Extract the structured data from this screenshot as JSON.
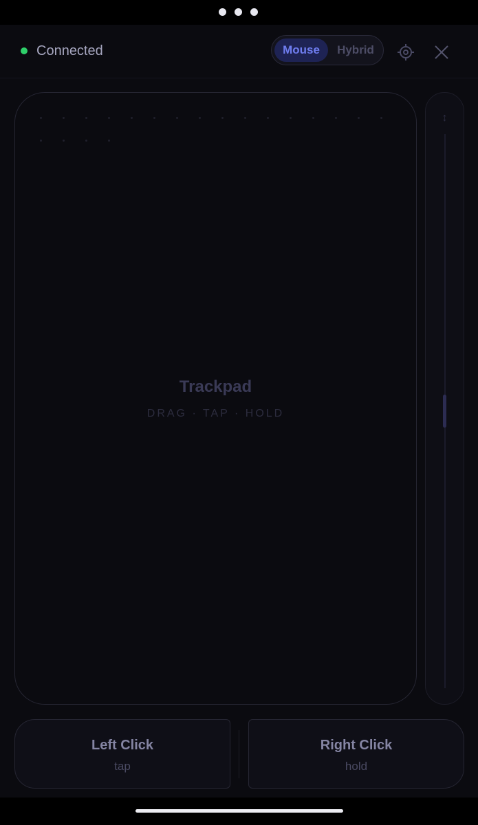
{
  "header": {
    "connection_status": "Connected",
    "connection_color": "#2fcf6a",
    "mode_options": [
      "Mouse",
      "Hybrid"
    ],
    "selected_mode": "Mouse",
    "settings_icon": "gear-icon",
    "close_icon": "close-icon"
  },
  "trackpad": {
    "title": "Trackpad",
    "hint": "DRAG · TAP · HOLD"
  },
  "scroll": {
    "icon": "↕",
    "position": 0.5
  },
  "buttons": {
    "left_title": "Left Click",
    "left_sub": "tap",
    "right_title": "Right Click",
    "right_sub": "hold"
  },
  "colors": {
    "accent": "#6f7df0",
    "background": "#0b0b10"
  }
}
